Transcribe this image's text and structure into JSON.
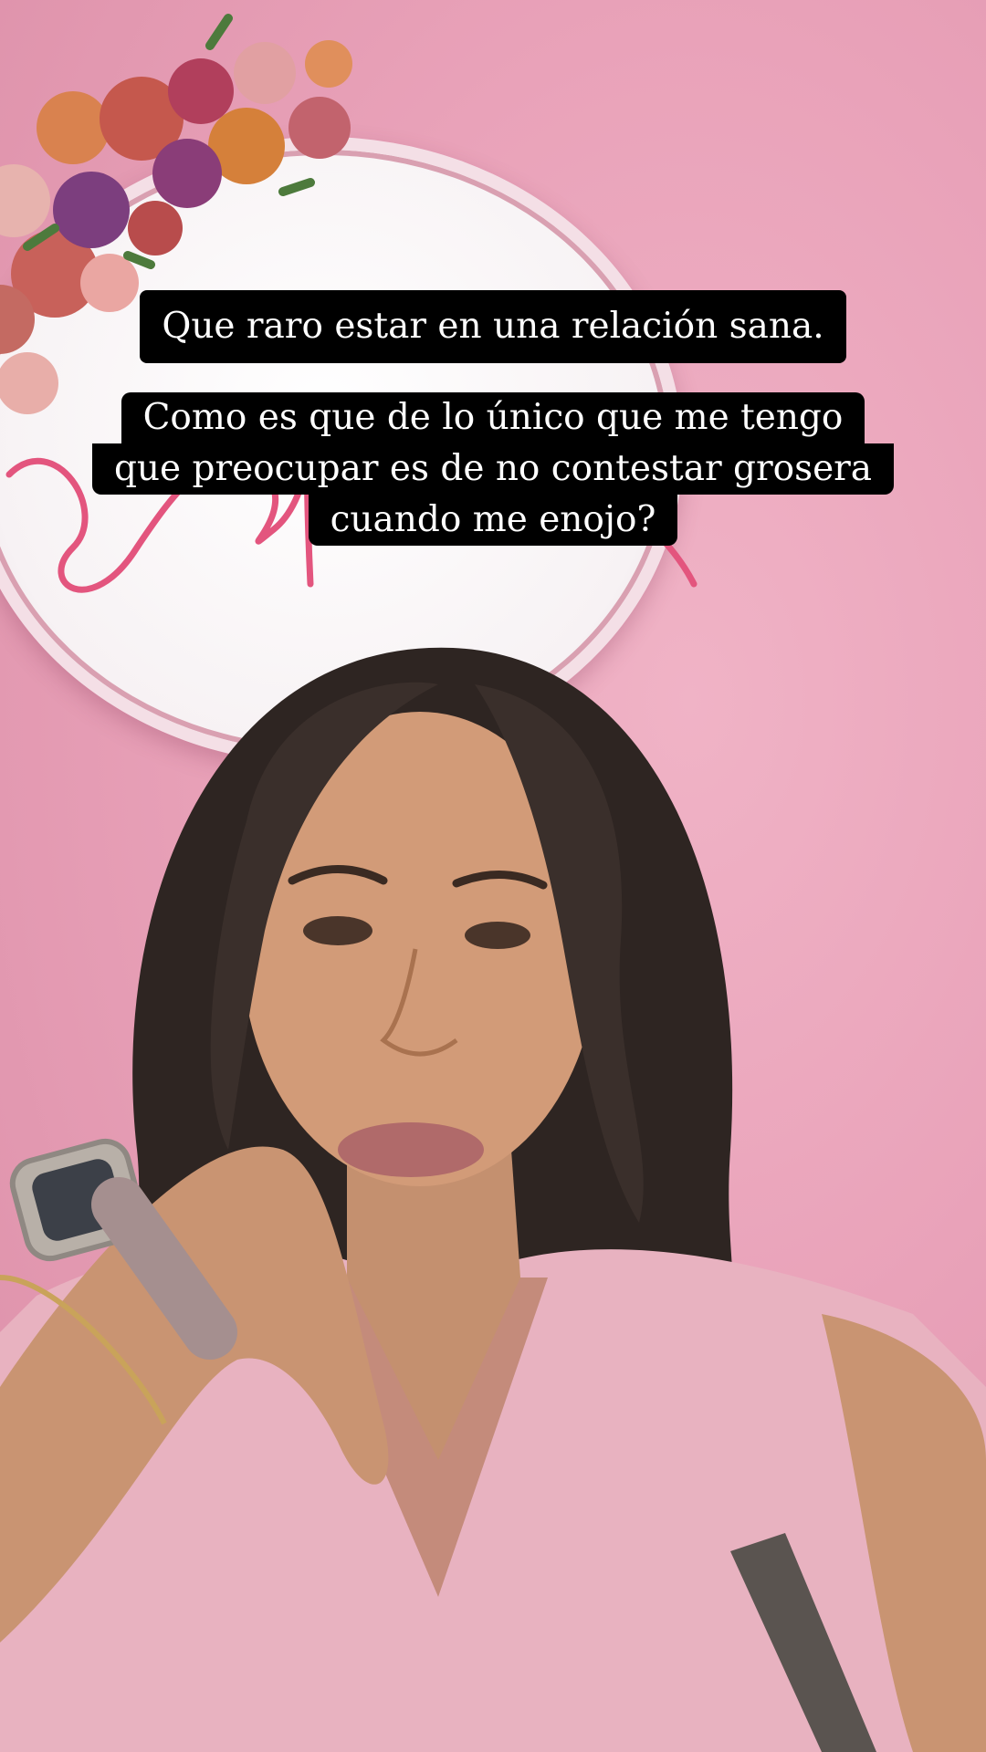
{
  "captions": {
    "first": "Que raro estar en una relación sana.",
    "second_lines": [
      "Como es que de lo único que me tengo",
      "que preocupar es de no contestar grosera",
      "cuando me enojo?"
    ]
  },
  "colors": {
    "wall": "#e9a6bc",
    "caption_bg": "#000000",
    "caption_text": "#ffffff",
    "shirt": "#e8b2c0",
    "hair": "#2e2522"
  }
}
